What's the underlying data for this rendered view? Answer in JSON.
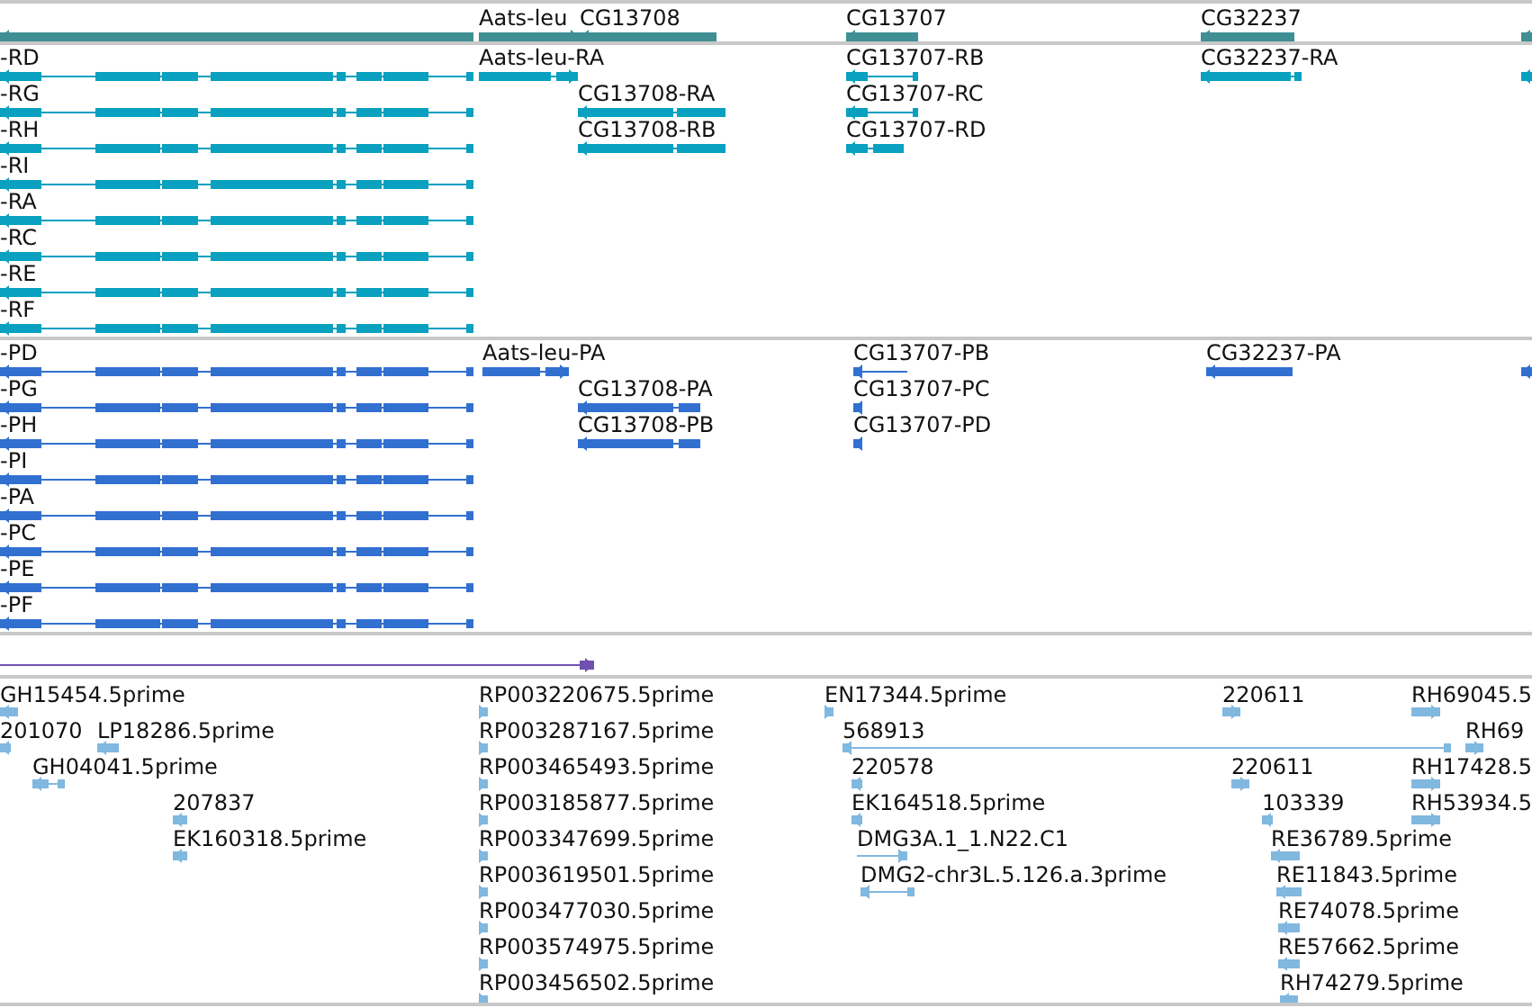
{
  "tracks": [
    {
      "kind": "gene",
      "features": [
        {
          "reverse": true
        },
        {
          "label": "Aats-leu",
          "reverse": false
        },
        {
          "label": "CG13708",
          "reverse": true
        },
        {
          "label": "CG13707",
          "reverse": true
        },
        {
          "label": "CG32237",
          "reverse": true
        },
        {
          "reverse": true
        }
      ]
    },
    {
      "kind": "transcript",
      "features": [
        {
          "label": "-RD",
          "reverse": true
        },
        {
          "label": "-RG",
          "reverse": true
        },
        {
          "label": "-RH",
          "reverse": true
        },
        {
          "label": "-RI",
          "reverse": true
        },
        {
          "label": "-RA",
          "reverse": true
        },
        {
          "label": "-RC",
          "reverse": true
        },
        {
          "label": "-RE",
          "reverse": true
        },
        {
          "label": "-RF",
          "reverse": true
        },
        {
          "label": "Aats-leu-RA",
          "reverse": false
        },
        {
          "label": "CG13708-RA",
          "reverse": true
        },
        {
          "label": "CG13708-RB",
          "reverse": true
        },
        {
          "label": "CG13707-RB",
          "reverse": true
        },
        {
          "label": "CG13707-RC",
          "reverse": true
        },
        {
          "label": "CG13707-RD",
          "reverse": true
        },
        {
          "label": "CG32237-RA",
          "reverse": true
        },
        {
          "reverse": true
        }
      ]
    },
    {
      "kind": "protein",
      "features": [
        {
          "label": "-PD",
          "reverse": true
        },
        {
          "label": "-PG",
          "reverse": true
        },
        {
          "label": "-PH",
          "reverse": true
        },
        {
          "label": "-PI",
          "reverse": true
        },
        {
          "label": "-PA",
          "reverse": true
        },
        {
          "label": "-PC",
          "reverse": true
        },
        {
          "label": "-PE",
          "reverse": true
        },
        {
          "label": "-PF",
          "reverse": true
        },
        {
          "label": "Aats-leu-PA",
          "reverse": false
        },
        {
          "label": "CG13708-PA",
          "reverse": true
        },
        {
          "label": "CG13708-PB",
          "reverse": true
        },
        {
          "label": "CG13707-PB",
          "reverse": true
        },
        {
          "label": "CG13707-PC",
          "reverse": true
        },
        {
          "label": "CG13707-PD",
          "reverse": true
        },
        {
          "label": "CG32237-PA",
          "reverse": true
        },
        {
          "reverse": true
        }
      ]
    },
    {
      "kind": "region",
      "features": [
        {
          "reverse": false
        }
      ]
    },
    {
      "kind": "est",
      "features": [
        {
          "label": "GH15454.5prime",
          "reverse": true
        },
        {
          "label": "201070",
          "reverse": true
        },
        {
          "label": "LP18286.5prime",
          "reverse": true
        },
        {
          "label": "GH04041.5prime",
          "reverse": true
        },
        {
          "label": "207837",
          "reverse": true
        },
        {
          "label": "EK160318.5prime",
          "reverse": true
        },
        {
          "label": "RP003220675.5prime",
          "reverse": false
        },
        {
          "label": "RP003287167.5prime",
          "reverse": false
        },
        {
          "label": "RP003465493.5prime",
          "reverse": false
        },
        {
          "label": "RP003185877.5prime",
          "reverse": false
        },
        {
          "label": "RP003347699.5prime",
          "reverse": false
        },
        {
          "label": "RP003619501.5prime",
          "reverse": false
        },
        {
          "label": "RP003477030.5prime",
          "reverse": false
        },
        {
          "label": "RP003574975.5prime",
          "reverse": false
        },
        {
          "label": "RP003456502.5prime",
          "reverse": false
        },
        {
          "label": "EN17344.5prime",
          "reverse": false
        },
        {
          "label": "568913",
          "reverse": true
        },
        {
          "label": "220578",
          "reverse": true
        },
        {
          "label": "EK164518.5prime",
          "reverse": true
        },
        {
          "label": "DMG3A.1_1.N22.C1",
          "reverse": false
        },
        {
          "label": "DMG2-chr3L.5.126.a.3prime",
          "reverse": true
        },
        {
          "label": "220611",
          "reverse": false
        },
        {
          "label": "220611",
          "reverse": false
        },
        {
          "label": "103339",
          "reverse": true
        },
        {
          "label": "RE36789.5prime",
          "reverse": true
        },
        {
          "label": "RE11843.5prime",
          "reverse": true
        },
        {
          "label": "RE74078.5prime",
          "reverse": true
        },
        {
          "label": "RE57662.5prime",
          "reverse": true
        },
        {
          "label": "RH74279.5prime",
          "reverse": true
        },
        {
          "label": "RH69045.5",
          "reverse": false
        },
        {
          "label": "RH69",
          "reverse": false
        },
        {
          "label": "RH17428.5",
          "reverse": false
        },
        {
          "label": "RH53934.5",
          "reverse": false
        }
      ]
    }
  ]
}
